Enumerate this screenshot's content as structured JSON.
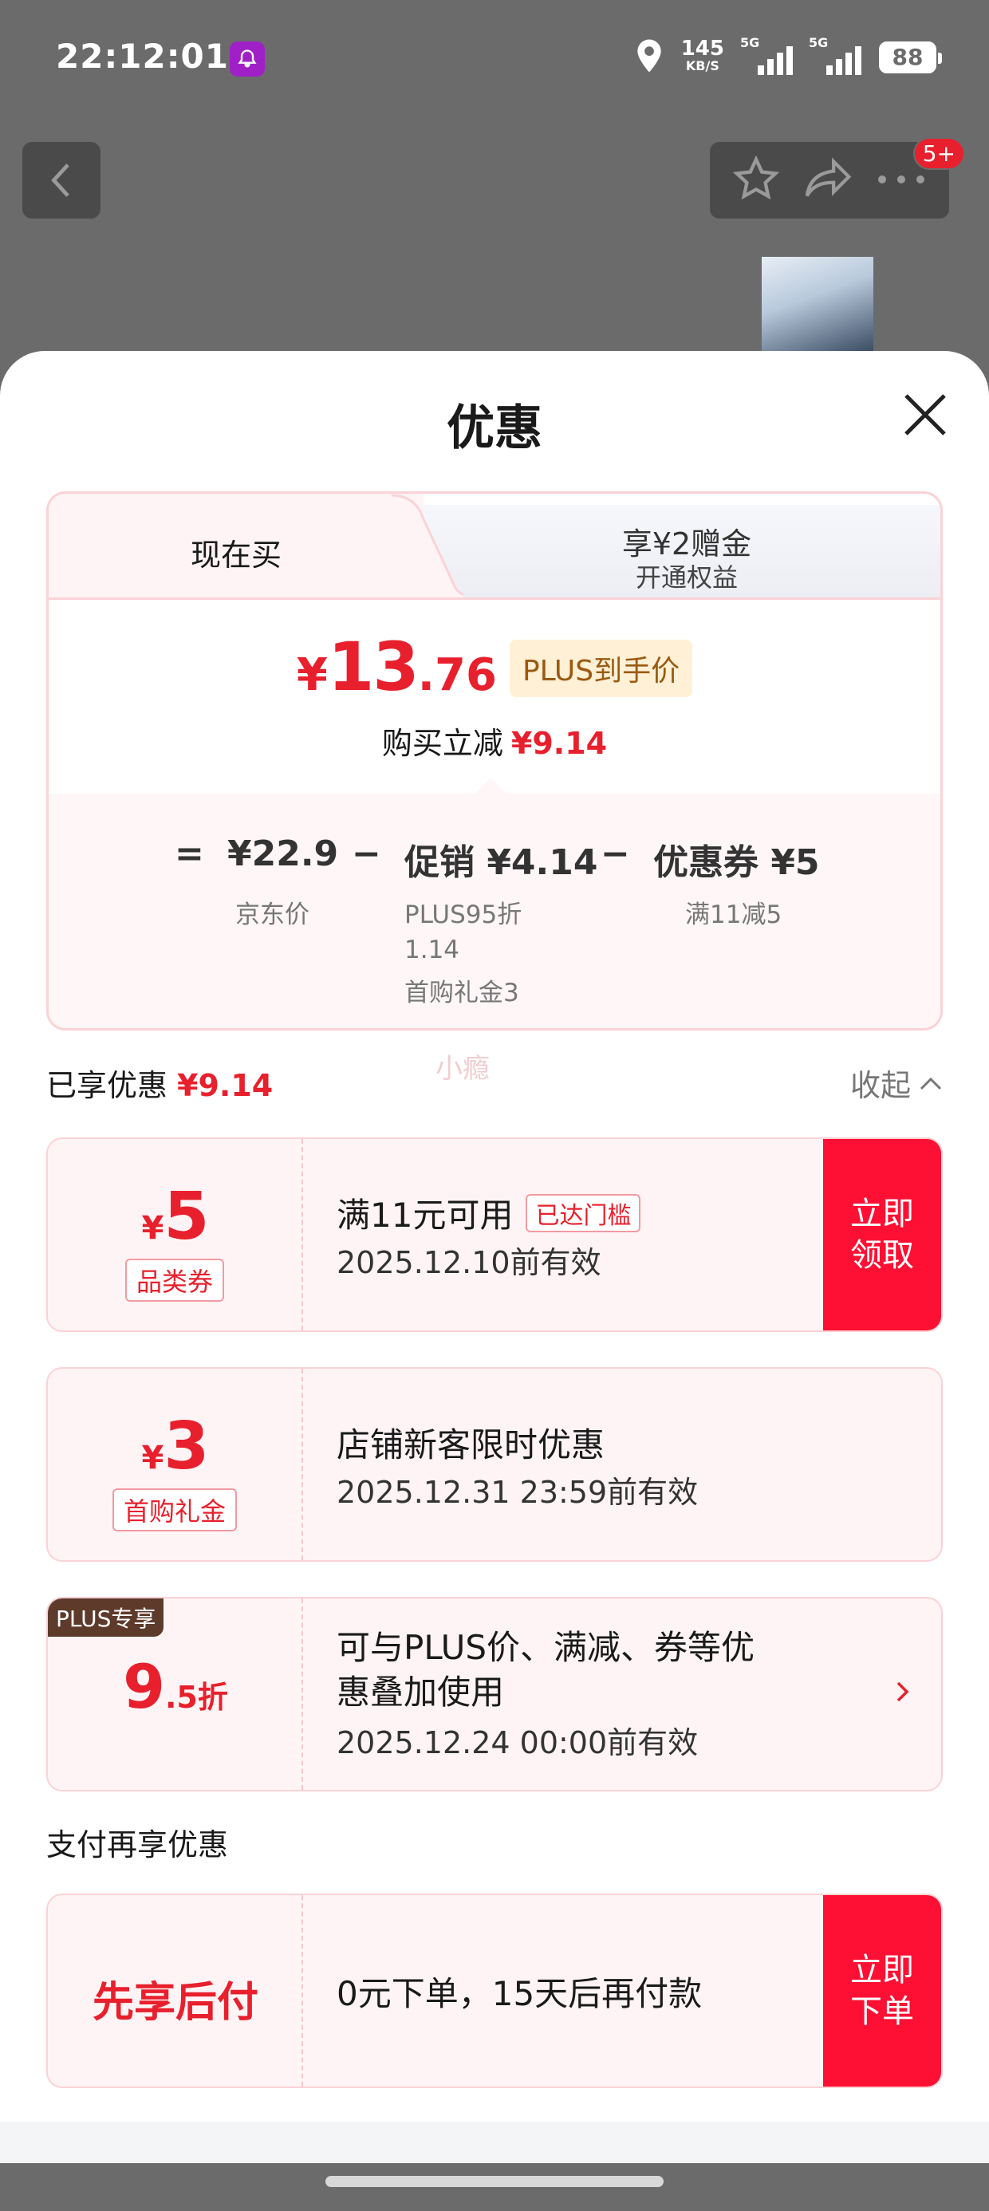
{
  "status_bar": {
    "time": "22:12:01",
    "net_speed": "145",
    "net_unit": "KB/S",
    "sig1_label": "5G",
    "sig2_label": "5G",
    "battery": "88"
  },
  "nav": {
    "badge": "5+"
  },
  "sheet": {
    "title": "优惠"
  },
  "price_card": {
    "tab_now": "现在买",
    "tab_plus_line1": "享¥2赠金",
    "tab_plus_line2": "开通权益",
    "currency": "¥",
    "price_int": "13",
    "price_dec": ".76",
    "plus_tag": "PLUS到手价",
    "reduce_label": "购买立减",
    "reduce_value": "¥9.14",
    "calc": {
      "eq": "=",
      "jd_price": "¥22.9",
      "minus1": "−",
      "promo": "促销 ¥4.14",
      "minus2": "−",
      "coupon": "优惠券 ¥5",
      "jd_price_label": "京东价",
      "promo_detail_1": "PLUS95折",
      "promo_detail_2": "1.14",
      "promo_detail_3": "首购礼金3",
      "coupon_detail": "满11减5"
    }
  },
  "enjoyed": {
    "label": "已享优惠",
    "value": "¥9.14",
    "collapse": "收起",
    "watermark": "小瘾"
  },
  "coupons": [
    {
      "symbol": "¥",
      "amount": "5",
      "tag": "品类券",
      "title": "满11元可用",
      "reached": "已达门槛",
      "validity": "2025.12.10前有效",
      "action_1": "立即",
      "action_2": "领取"
    },
    {
      "symbol": "¥",
      "amount": "3",
      "tag": "首购礼金",
      "title": "店铺新客限时优惠",
      "validity": "2025.12.31 23:59前有效"
    },
    {
      "plus_only": "PLUS专享",
      "discount_int": "9",
      "discount_dec": ".5折",
      "title_1": "可与PLUS价、满减、券等优",
      "title_2": "惠叠加使用",
      "validity": "2025.12.24 00:00前有效"
    }
  ],
  "payment": {
    "section_title": "支付再享优惠",
    "name": "先享后付",
    "desc": "0元下单，15天后再付款",
    "action_1": "立即",
    "action_2": "下单"
  },
  "colors": {
    "accent": "#e8202d",
    "action_bg": "#fd1033",
    "card_bg": "#fff4f5",
    "card_border": "#fbd2d6",
    "plus_badge": "#5e3a2a"
  }
}
